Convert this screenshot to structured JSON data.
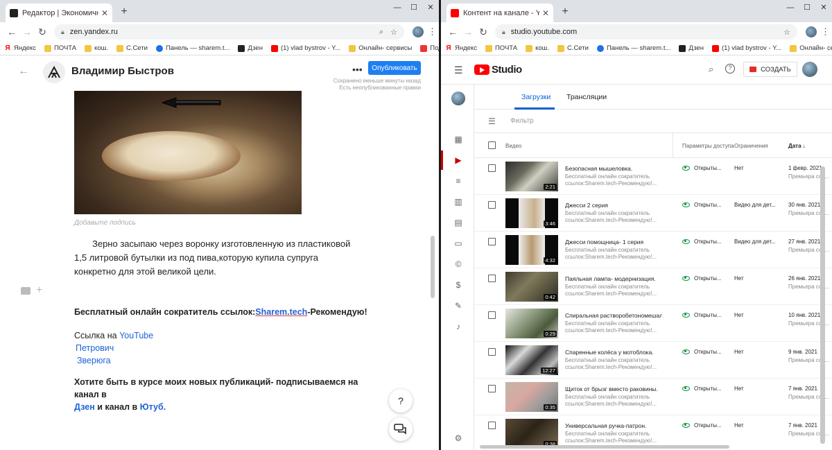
{
  "left": {
    "tab_title": "Редактор | Экономичная корм",
    "url": "zen.yandex.ru",
    "bookmarks": [
      "Яндекс",
      "ПОЧТА",
      "кош.",
      "C.Сети",
      "Панель — sharem.t...",
      "Дзен",
      "(1) vlad bystrov - Y...",
      "Онлайн- сервисы",
      "Подбор слов"
    ],
    "author": "Владимир Быстров",
    "publish_label": "Опубликовать",
    "saved_line1": "Сохранено меньше минуты назад",
    "saved_line2": "Есть неопубликованные правки",
    "caption_placeholder": "Добавьте подпись",
    "paragraph": "Зерно засыпаю через воронку изготовленную из пластиковой 1,5 литровой бутылки из под пива,которую купила супруга конкретно для этой великой цели.",
    "promo_prefix": "Бесплатный онлайн сократитель ссылок:",
    "promo_link": "Sharem.tech",
    "promo_suffix": "-Рекомендую!",
    "links_prefix": "Ссылка на ",
    "link_youtube": "YouTube",
    "link_petrovich": "Петрович",
    "link_zveryuga": "Зверюга",
    "subscribe_text": "Хотите быть в курсе моих новых публикаций- подписываемся на канал в",
    "sub_link_dzen": "Дзен",
    "sub_mid": " и канал в ",
    "sub_link_yt": "Ютуб.",
    "help_label": "?"
  },
  "right": {
    "tab_title": "Контент на канале - YouTube St",
    "url": "studio.youtube.com",
    "bookmarks": [
      "Яндекс",
      "ПОЧТА",
      "кош.",
      "C.Сети",
      "Панель — sharem.t...",
      "Дзен",
      "(1) vlad bystrov - Y...",
      "Онлайн- сервисы"
    ],
    "logo_text": "Studio",
    "create_label": "СОЗДАТЬ",
    "tabs": [
      "Загрузки",
      "Трансляции"
    ],
    "filter_label": "Фильтр",
    "headers": {
      "video": "Видео",
      "access": "Параметры доступа",
      "restrictions": "Ограничения",
      "date": "Дата"
    },
    "rows": [
      {
        "title": "Безопасная мышеловка.",
        "desc1": "Бесплатный онлайн сократитель",
        "desc2": "ссылок:Sharem.tech-Рекомендую!...",
        "duration": "2:21",
        "visibility": "Открыты...",
        "restriction": "Нет",
        "date": "1 февр. 2021",
        "date_sub": "Премьера сос..."
      },
      {
        "title": "Джесси 2 серия",
        "desc1": "Бесплатный онлайн сократитель",
        "desc2": "ссылок:Sharem.tech-Рекомендую!...",
        "duration": "3:46",
        "visibility": "Открыты...",
        "restriction": "Видео для дет...",
        "date": "30 янв. 2021",
        "date_sub": "Премьера сос..."
      },
      {
        "title": "Джесси помощница- 1 серия",
        "desc1": "Бесплатный онлайн сократитель",
        "desc2": "ссылок:Sharem.tech-Рекомендую!...",
        "duration": "4:32",
        "visibility": "Открыты...",
        "restriction": "Видео для дет...",
        "date": "27 янв. 2021",
        "date_sub": "Премьера сос..."
      },
      {
        "title": "Паяльная лампа- модернизация.",
        "desc1": "Бесплатный онлайн сократитель",
        "desc2": "ссылок:Sharem.tech-Рекомендую!...",
        "duration": "0:42",
        "visibility": "Открыты...",
        "restriction": "Нет",
        "date": "26 янв. 2021",
        "date_sub": "Премьера сос..."
      },
      {
        "title": "Спиральная растворобетономешал...",
        "desc1": "Бесплатный онлайн сократитель",
        "desc2": "ссылок:Sharem.tech-Рекомендую!...",
        "duration": "0:29",
        "visibility": "Открыты...",
        "restriction": "Нет",
        "date": "10 янв. 2021",
        "date_sub": "Премьера сос..."
      },
      {
        "title": "Спаренные колёса у мотоблока.",
        "desc1": "Бесплатный онлайн сократитель",
        "desc2": "ссылок:Sharem.tech-Рекомендую!...",
        "duration": "12:27",
        "visibility": "Открыты...",
        "restriction": "Нет",
        "date": "9 янв. 2021",
        "date_sub": "Премьера сос..."
      },
      {
        "title": "Щиток от брызг вместо раковины.",
        "desc1": "Бесплатный онлайн сократитель",
        "desc2": "ссылок:Sharem.tech-Рекомендую!...",
        "duration": "0:35",
        "visibility": "Открыты...",
        "restriction": "Нет",
        "date": "7 янв. 2021",
        "date_sub": "Премьера сос..."
      },
      {
        "title": "Универсальная ручка-патрон.",
        "desc1": "Бесплатный онлайн сократитель",
        "desc2": "ссылок:Sharem.tech-Рекомендую!...",
        "duration": "0:38",
        "visibility": "Открыты...",
        "restriction": "Нет",
        "date": "7 янв. 2021",
        "date_sub": "Премьера сос..."
      }
    ]
  },
  "colors": {
    "zen_blue": "#1e7ff0",
    "yt_red": "#ff0000",
    "yt_blue": "#065fd4",
    "visibility_green": "#0a8f3a"
  }
}
